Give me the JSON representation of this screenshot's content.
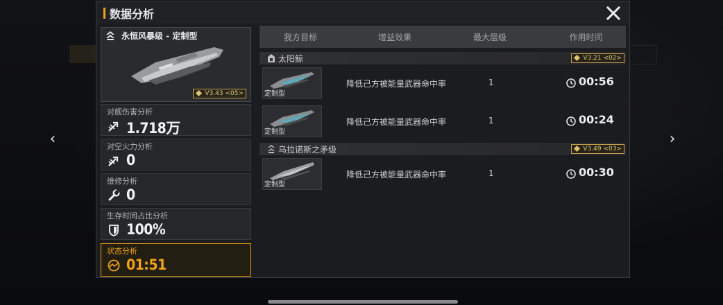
{
  "dialog": {
    "title": "数据分析"
  },
  "ship": {
    "name": "永恒风暴级 - 定制型",
    "version": "V3.43 <05>"
  },
  "stats": [
    {
      "label": "对舰伤害分析",
      "value": "1.718万",
      "icon": "damage-arrow-icon"
    },
    {
      "label": "对空火力分析",
      "value": "0",
      "icon": "anti-air-arrow-icon"
    },
    {
      "label": "维修分析",
      "value": "0",
      "icon": "wrench-icon"
    },
    {
      "label": "生存时间占比分析",
      "value": "100%",
      "icon": "shield-icon"
    },
    {
      "label": "状态分析",
      "value": "01:51",
      "icon": "status-gauge-icon"
    }
  ],
  "table": {
    "columns": [
      "我方目标",
      "增益效果",
      "最大层级",
      "作用时间"
    ],
    "groups": [
      {
        "name": "太阳鲸",
        "version": "V3.21 <02>",
        "rows": [
          {
            "target_label": "定制型",
            "effect": "降低己方被能量武器命中率",
            "level": "1",
            "time": "00:56"
          },
          {
            "target_label": "定制型",
            "effect": "降低己方被能量武器命中率",
            "level": "1",
            "time": "00:24"
          }
        ]
      },
      {
        "name": "乌拉诺斯之矛级",
        "version": "V3.49 <03>",
        "rows": [
          {
            "target_label": "定制型",
            "effect": "降低己方被能量武器命中率",
            "level": "1",
            "time": "00:30"
          }
        ]
      }
    ]
  },
  "colors": {
    "accent": "#f0a21a",
    "badge": "#e2c46d",
    "panel": "#1b1c1f"
  }
}
